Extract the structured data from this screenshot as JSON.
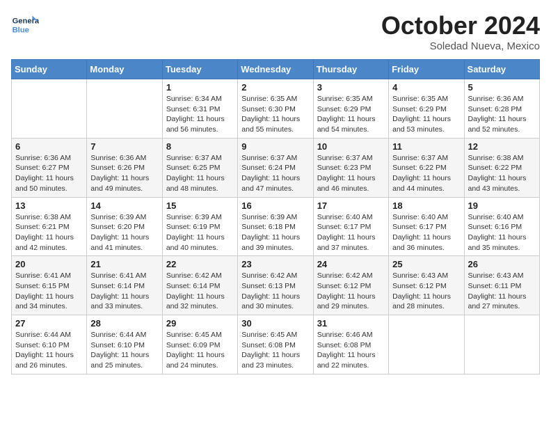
{
  "header": {
    "logo_general": "General",
    "logo_blue": "Blue",
    "month_title": "October 2024",
    "location": "Soledad Nueva, Mexico"
  },
  "weekdays": [
    "Sunday",
    "Monday",
    "Tuesday",
    "Wednesday",
    "Thursday",
    "Friday",
    "Saturday"
  ],
  "weeks": [
    [
      {
        "day": "",
        "info": ""
      },
      {
        "day": "",
        "info": ""
      },
      {
        "day": "1",
        "info": "Sunrise: 6:34 AM\nSunset: 6:31 PM\nDaylight: 11 hours and 56 minutes."
      },
      {
        "day": "2",
        "info": "Sunrise: 6:35 AM\nSunset: 6:30 PM\nDaylight: 11 hours and 55 minutes."
      },
      {
        "day": "3",
        "info": "Sunrise: 6:35 AM\nSunset: 6:29 PM\nDaylight: 11 hours and 54 minutes."
      },
      {
        "day": "4",
        "info": "Sunrise: 6:35 AM\nSunset: 6:29 PM\nDaylight: 11 hours and 53 minutes."
      },
      {
        "day": "5",
        "info": "Sunrise: 6:36 AM\nSunset: 6:28 PM\nDaylight: 11 hours and 52 minutes."
      }
    ],
    [
      {
        "day": "6",
        "info": "Sunrise: 6:36 AM\nSunset: 6:27 PM\nDaylight: 11 hours and 50 minutes."
      },
      {
        "day": "7",
        "info": "Sunrise: 6:36 AM\nSunset: 6:26 PM\nDaylight: 11 hours and 49 minutes."
      },
      {
        "day": "8",
        "info": "Sunrise: 6:37 AM\nSunset: 6:25 PM\nDaylight: 11 hours and 48 minutes."
      },
      {
        "day": "9",
        "info": "Sunrise: 6:37 AM\nSunset: 6:24 PM\nDaylight: 11 hours and 47 minutes."
      },
      {
        "day": "10",
        "info": "Sunrise: 6:37 AM\nSunset: 6:23 PM\nDaylight: 11 hours and 46 minutes."
      },
      {
        "day": "11",
        "info": "Sunrise: 6:37 AM\nSunset: 6:22 PM\nDaylight: 11 hours and 44 minutes."
      },
      {
        "day": "12",
        "info": "Sunrise: 6:38 AM\nSunset: 6:22 PM\nDaylight: 11 hours and 43 minutes."
      }
    ],
    [
      {
        "day": "13",
        "info": "Sunrise: 6:38 AM\nSunset: 6:21 PM\nDaylight: 11 hours and 42 minutes."
      },
      {
        "day": "14",
        "info": "Sunrise: 6:39 AM\nSunset: 6:20 PM\nDaylight: 11 hours and 41 minutes."
      },
      {
        "day": "15",
        "info": "Sunrise: 6:39 AM\nSunset: 6:19 PM\nDaylight: 11 hours and 40 minutes."
      },
      {
        "day": "16",
        "info": "Sunrise: 6:39 AM\nSunset: 6:18 PM\nDaylight: 11 hours and 39 minutes."
      },
      {
        "day": "17",
        "info": "Sunrise: 6:40 AM\nSunset: 6:17 PM\nDaylight: 11 hours and 37 minutes."
      },
      {
        "day": "18",
        "info": "Sunrise: 6:40 AM\nSunset: 6:17 PM\nDaylight: 11 hours and 36 minutes."
      },
      {
        "day": "19",
        "info": "Sunrise: 6:40 AM\nSunset: 6:16 PM\nDaylight: 11 hours and 35 minutes."
      }
    ],
    [
      {
        "day": "20",
        "info": "Sunrise: 6:41 AM\nSunset: 6:15 PM\nDaylight: 11 hours and 34 minutes."
      },
      {
        "day": "21",
        "info": "Sunrise: 6:41 AM\nSunset: 6:14 PM\nDaylight: 11 hours and 33 minutes."
      },
      {
        "day": "22",
        "info": "Sunrise: 6:42 AM\nSunset: 6:14 PM\nDaylight: 11 hours and 32 minutes."
      },
      {
        "day": "23",
        "info": "Sunrise: 6:42 AM\nSunset: 6:13 PM\nDaylight: 11 hours and 30 minutes."
      },
      {
        "day": "24",
        "info": "Sunrise: 6:42 AM\nSunset: 6:12 PM\nDaylight: 11 hours and 29 minutes."
      },
      {
        "day": "25",
        "info": "Sunrise: 6:43 AM\nSunset: 6:12 PM\nDaylight: 11 hours and 28 minutes."
      },
      {
        "day": "26",
        "info": "Sunrise: 6:43 AM\nSunset: 6:11 PM\nDaylight: 11 hours and 27 minutes."
      }
    ],
    [
      {
        "day": "27",
        "info": "Sunrise: 6:44 AM\nSunset: 6:10 PM\nDaylight: 11 hours and 26 minutes."
      },
      {
        "day": "28",
        "info": "Sunrise: 6:44 AM\nSunset: 6:10 PM\nDaylight: 11 hours and 25 minutes."
      },
      {
        "day": "29",
        "info": "Sunrise: 6:45 AM\nSunset: 6:09 PM\nDaylight: 11 hours and 24 minutes."
      },
      {
        "day": "30",
        "info": "Sunrise: 6:45 AM\nSunset: 6:08 PM\nDaylight: 11 hours and 23 minutes."
      },
      {
        "day": "31",
        "info": "Sunrise: 6:46 AM\nSunset: 6:08 PM\nDaylight: 11 hours and 22 minutes."
      },
      {
        "day": "",
        "info": ""
      },
      {
        "day": "",
        "info": ""
      }
    ]
  ]
}
